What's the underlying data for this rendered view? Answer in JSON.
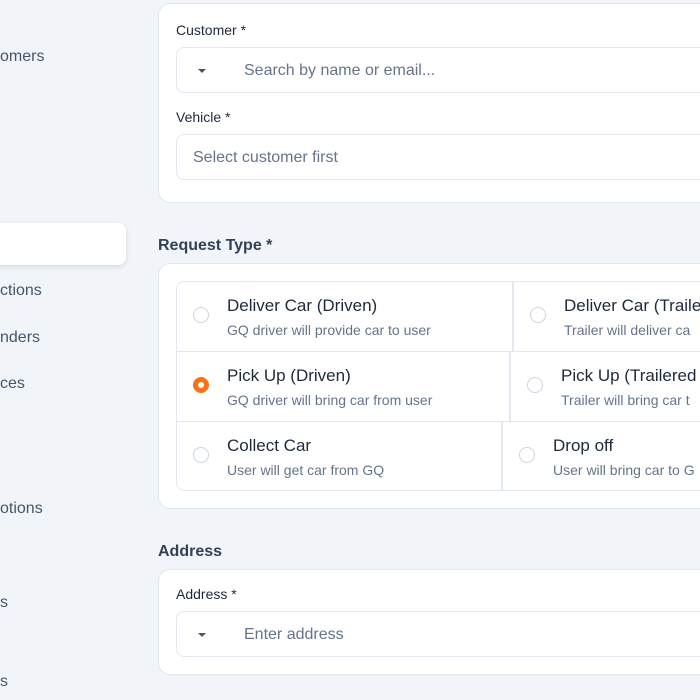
{
  "sidebar": {
    "items": [
      {
        "label": "omers"
      },
      {
        "label": ""
      },
      {
        "label": "ctions"
      },
      {
        "label": "nders"
      },
      {
        "label": "ces"
      },
      {
        "label": "otions"
      },
      {
        "label": "s"
      },
      {
        "label": "s"
      }
    ]
  },
  "customer_card": {
    "customer_label": "Customer *",
    "customer_placeholder": "Search by name or email...",
    "vehicle_label": "Vehicle *",
    "vehicle_placeholder": "Select customer first"
  },
  "request_type": {
    "title": "Request Type *",
    "selected": "pick_up_driven",
    "options": [
      {
        "id": "deliver_driven",
        "title": "Deliver Car (Driven)",
        "desc": "GQ driver will provide car to user"
      },
      {
        "id": "deliver_trailered",
        "title": "Deliver Car (Traile",
        "desc": "Trailer will deliver ca"
      },
      {
        "id": "pick_up_driven",
        "title": "Pick Up (Driven)",
        "desc": "GQ driver will bring car from user"
      },
      {
        "id": "pick_up_trailered",
        "title": "Pick Up (Trailered",
        "desc": "Trailer will bring car t"
      },
      {
        "id": "collect_car",
        "title": "Collect Car",
        "desc": "User will get car from GQ"
      },
      {
        "id": "drop_off",
        "title": "Drop off",
        "desc": "User will bring car to G"
      }
    ]
  },
  "address": {
    "title": "Address",
    "field_label": "Address *",
    "placeholder": "Enter address"
  },
  "colors": {
    "accent": "#f97316",
    "background": "#f1f5f9",
    "card": "#ffffff",
    "border": "#e2e8f0"
  }
}
